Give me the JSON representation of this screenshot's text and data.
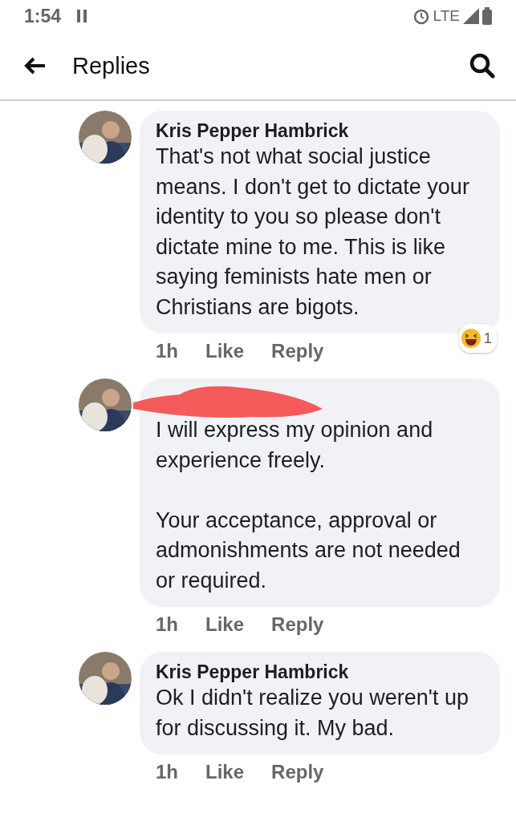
{
  "status_bar": {
    "time": "1:54",
    "network": "LTE"
  },
  "app_bar": {
    "title": "Replies"
  },
  "comments": [
    {
      "author": "Kris Pepper Hambrick",
      "redacted": false,
      "text": "That's not what social justice means. I don't get to dictate your identity to you so please don't dictate mine to me. This is like saying feminists hate men or Christians are bigots.",
      "time": "1h",
      "like": "Like",
      "reply": "Reply",
      "reactions": {
        "count": "1"
      }
    },
    {
      "redacted": true,
      "text": "I will express my opinion and experience freely.\n\nYour acceptance, approval or admonishments are not needed or required.",
      "time": "1h",
      "like": "Like",
      "reply": "Reply"
    },
    {
      "author": "Kris Pepper Hambrick",
      "redacted": false,
      "text": "Ok I didn't realize you weren't up for discussing it. My bad.",
      "time": "1h",
      "like": "Like",
      "reply": "Reply"
    }
  ]
}
